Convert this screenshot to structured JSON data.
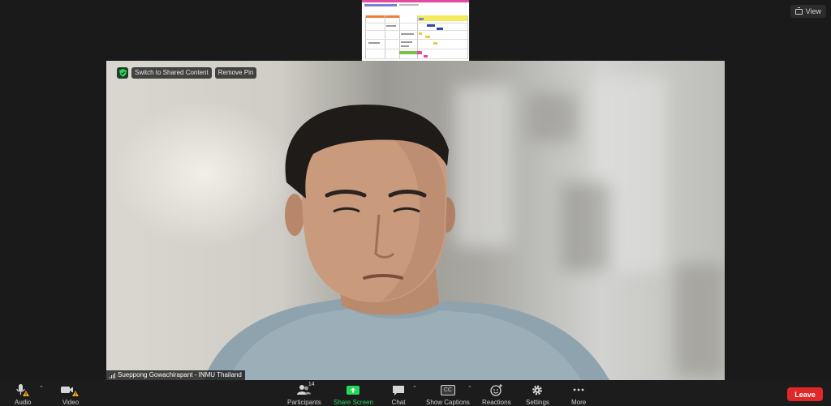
{
  "top": {
    "view_label": "View"
  },
  "video": {
    "switch_label": "Switch to Shared Content",
    "remove_pin_label": "Remove Pin",
    "participant_name": "Sueppong Gowachirapant - INMU Thailand"
  },
  "toolbar": {
    "audio_label": "Audio",
    "video_label": "Video",
    "participants_label": "Participants",
    "participants_count": "14",
    "share_label": "Share Screen",
    "chat_label": "Chat",
    "captions_label": "Show Captions",
    "captions_glyph": "CC",
    "reactions_label": "Reactions",
    "settings_label": "Settings",
    "more_label": "More",
    "leave_label": "Leave"
  },
  "colors": {
    "accent_green": "#23d959",
    "leave_red": "#e02828",
    "toolbar_bg": "#1c1c1c",
    "warning_yellow": "#f5a623"
  },
  "icons": [
    "view-icon",
    "shield-icon",
    "signal-icon",
    "microphone-icon",
    "camera-icon",
    "participants-icon",
    "share-screen-icon",
    "chat-icon",
    "captions-icon",
    "reactions-icon",
    "gear-icon",
    "more-icon",
    "caret-up-icon",
    "warning-icon"
  ]
}
